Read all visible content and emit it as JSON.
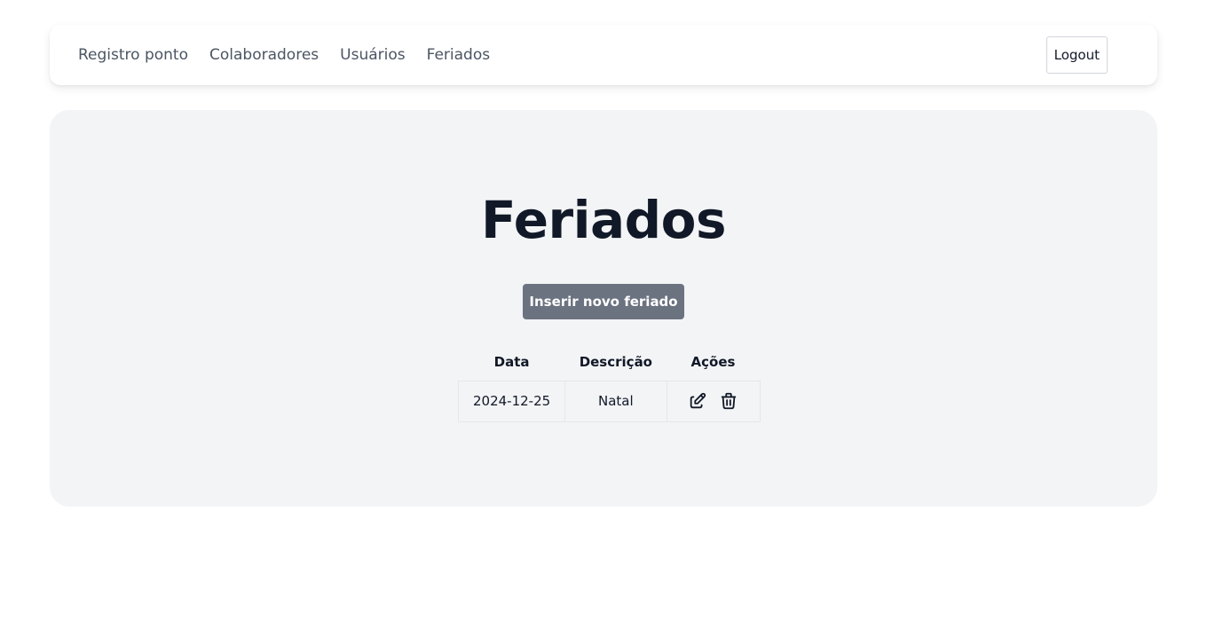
{
  "nav": {
    "links": [
      {
        "label": "Registro ponto"
      },
      {
        "label": "Colaboradores"
      },
      {
        "label": "Usuários"
      },
      {
        "label": "Feriados"
      }
    ],
    "logout_label": "Logout"
  },
  "main": {
    "title": "Feriados",
    "insert_button_label": "Inserir novo feriado",
    "table": {
      "headers": [
        "Data",
        "Descrição",
        "Ações"
      ],
      "rows": [
        {
          "data": "2024-12-25",
          "descricao": "Natal",
          "actions": [
            "edit-icon",
            "trash-icon"
          ]
        }
      ]
    }
  },
  "colors": {
    "nav_text": "#4b5563",
    "card_background": "#f3f4f6",
    "primary_button": "#6b7280",
    "title_text": "#111827"
  }
}
